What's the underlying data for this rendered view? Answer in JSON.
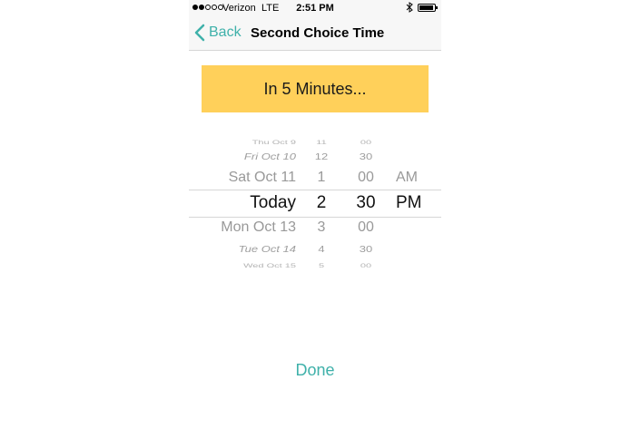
{
  "status_bar": {
    "carrier": "Verizon",
    "network": "LTE",
    "time": "2:51 PM",
    "signal_bars_filled": 2,
    "signal_bars_total": 5
  },
  "nav": {
    "back_label": "Back",
    "title": "Second Choice Time"
  },
  "quick_button": {
    "label": "In 5 Minutes..."
  },
  "picker": {
    "days": [
      "Thu Oct 9",
      "Fri Oct 10",
      "Sat Oct 11",
      "Today",
      "Mon Oct 13",
      "Tue Oct 14",
      "Wed Oct 15"
    ],
    "hours": [
      "11",
      "12",
      "1",
      "2",
      "3",
      "4",
      "5"
    ],
    "minutes": [
      "00",
      "30",
      "00",
      "30",
      "00",
      "30",
      "00"
    ],
    "ampm": [
      "AM",
      "PM"
    ],
    "selected": {
      "day": "Today",
      "hour": "2",
      "minute": "30",
      "ampm": "PM"
    }
  },
  "done": {
    "label": "Done"
  },
  "colors": {
    "accent": "#3fb1aa",
    "button_yellow": "#ffd05a"
  }
}
